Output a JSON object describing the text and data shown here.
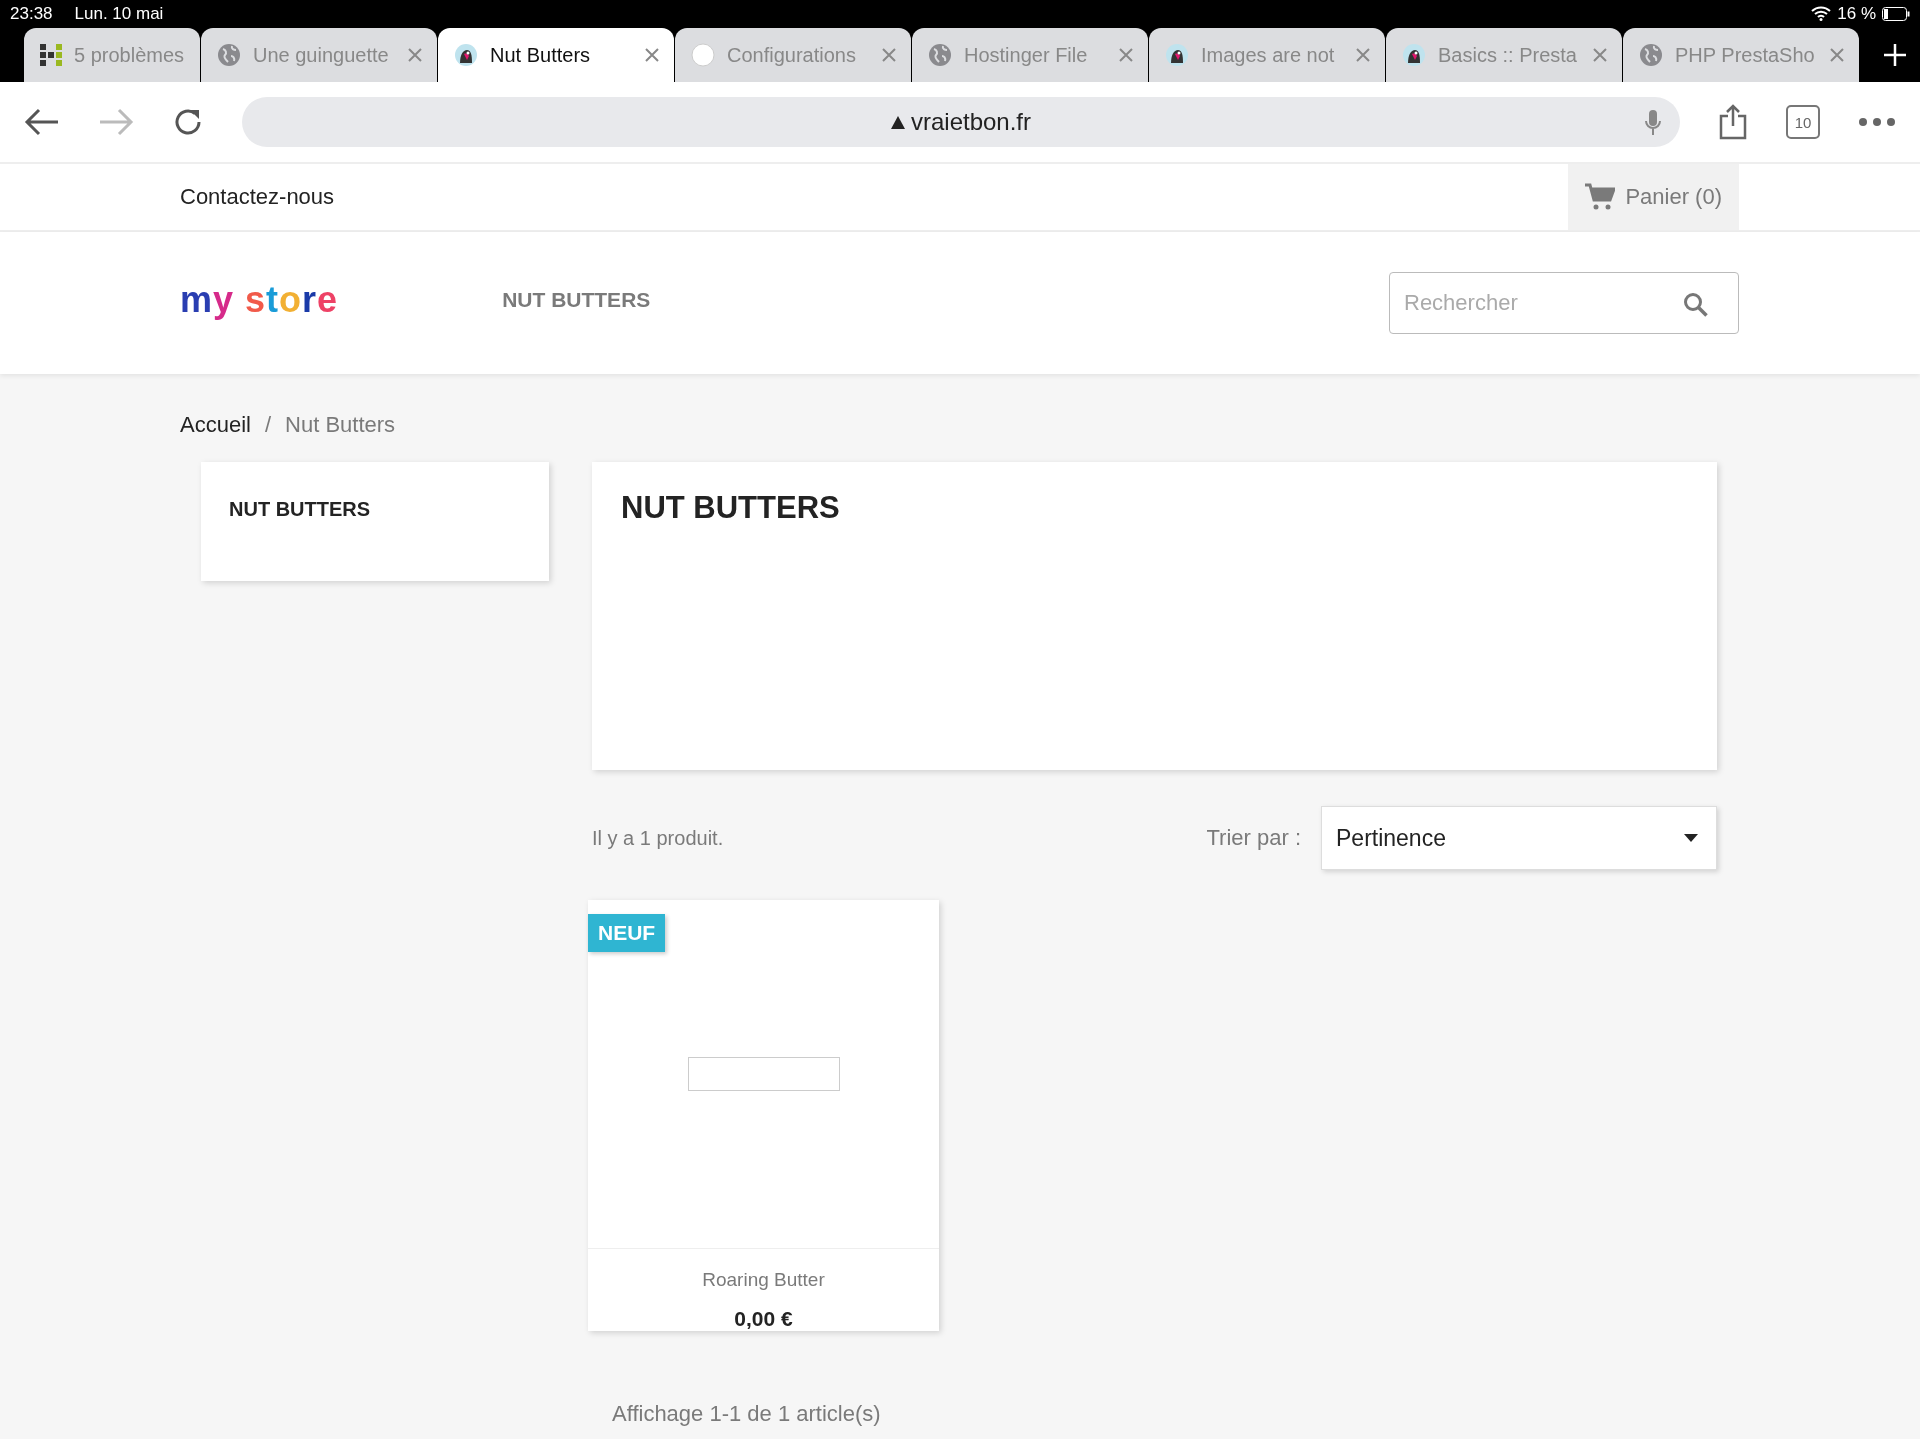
{
  "status_bar": {
    "time": "23:38",
    "date": "Lun. 10 mai",
    "battery": "16 %"
  },
  "tabs": [
    {
      "title": "5 problèmes",
      "kind": "grid",
      "selected": false
    },
    {
      "title": "Une guinguette",
      "kind": "globe",
      "selected": false
    },
    {
      "title": "Nut Butters",
      "kind": "bird",
      "selected": true
    },
    {
      "title": "Configurations",
      "kind": "circle",
      "selected": false
    },
    {
      "title": "Hostinger File",
      "kind": "globe",
      "selected": false
    },
    {
      "title": "Images are not",
      "kind": "bird",
      "selected": false
    },
    {
      "title": "Basics :: Presta",
      "kind": "bird",
      "selected": false
    },
    {
      "title": "PHP PrestaSho",
      "kind": "globe",
      "selected": false
    }
  ],
  "toolbar": {
    "url": "vraietbon.fr",
    "tab_count": "10"
  },
  "top_nav": {
    "contact": "Contactez-nous",
    "cart": "Panier (0)"
  },
  "header": {
    "logo": "my store",
    "menu": "NUT BUTTERS",
    "search": {
      "placeholder": "Rechercher"
    }
  },
  "breadcrumb": {
    "separator": "/",
    "items": [
      "Accueil",
      "Nut Butters"
    ]
  },
  "sidebar": {
    "title": "NUT BUTTERS"
  },
  "category": {
    "title": "NUT BUTTERS"
  },
  "listing": {
    "count": "Il y a 1 produit.",
    "sort_label": "Trier par :",
    "sort_value": "Pertinence"
  },
  "products": [
    {
      "badge": "NEUF",
      "name": "Roaring Butter",
      "price": "0,00 €"
    }
  ],
  "pagination": "Affichage 1-1 de 1 article(s)"
}
